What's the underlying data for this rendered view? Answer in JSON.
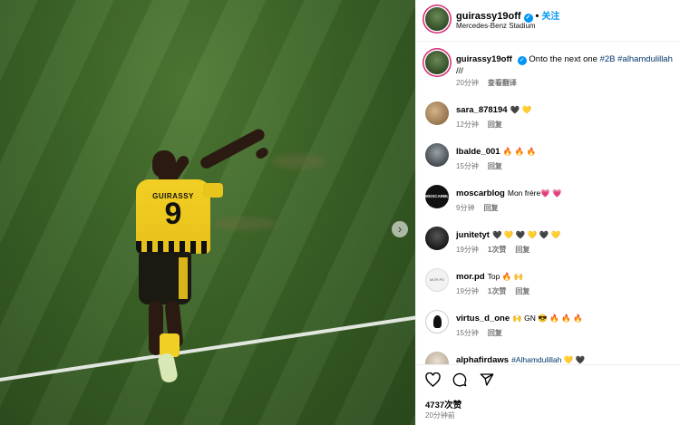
{
  "post": {
    "username": "guirassy19off",
    "follow_label": "关注",
    "location": "Mercedes-Benz Stadium",
    "jersey_name": "GUIRASSY",
    "jersey_number": "9",
    "caption": {
      "text": "Onto the next one ",
      "hashtags": "#2B #alhamdulillah",
      "tail": "///",
      "time": "20分钟",
      "translate_label": "查看翻译"
    }
  },
  "comments": [
    {
      "user": "sara_878194",
      "text": "🖤 💛",
      "time": "12分钟",
      "likes": "",
      "reply": "回复",
      "avatar": "sara"
    },
    {
      "user": "lbalde_001",
      "text": "🔥 🔥 🔥",
      "time": "15分钟",
      "likes": "",
      "reply": "回复",
      "avatar": "lbalde"
    },
    {
      "user": "moscarblog",
      "text": "Mon frère💗 💗",
      "time": "9分钟",
      "likes": "",
      "reply": "回复",
      "avatar": "moscar",
      "avatar_text": "MOSCARBLOG"
    },
    {
      "user": "junitetyt",
      "text": "🖤 💛 🖤 💛 🖤 💛",
      "time": "19分钟",
      "likes": "1次赞",
      "reply": "回复",
      "avatar": "junite"
    },
    {
      "user": "mor.pd",
      "text": "Top 🔥 🙌",
      "time": "19分钟",
      "likes": "1次赞",
      "reply": "回复",
      "avatar": "mor",
      "avatar_text": "MOR.PD"
    },
    {
      "user": "virtus_d_one",
      "text": "🙌 GN 😎 🔥 🔥 🔥",
      "time": "15分钟",
      "likes": "",
      "reply": "回复",
      "avatar": "virtus"
    },
    {
      "user": "alphafirdaws",
      "text": "#Alhamdulillah 💛 🖤",
      "time": "",
      "likes": "",
      "reply": "",
      "avatar": "alpha"
    }
  ],
  "footer": {
    "likes": "4737次赞",
    "time": "20分钟前"
  },
  "icons": {
    "next": "chevron-right-icon",
    "like": "heart-icon",
    "comment": "comment-icon",
    "share": "share-icon",
    "verified": "verified-badge-icon"
  }
}
